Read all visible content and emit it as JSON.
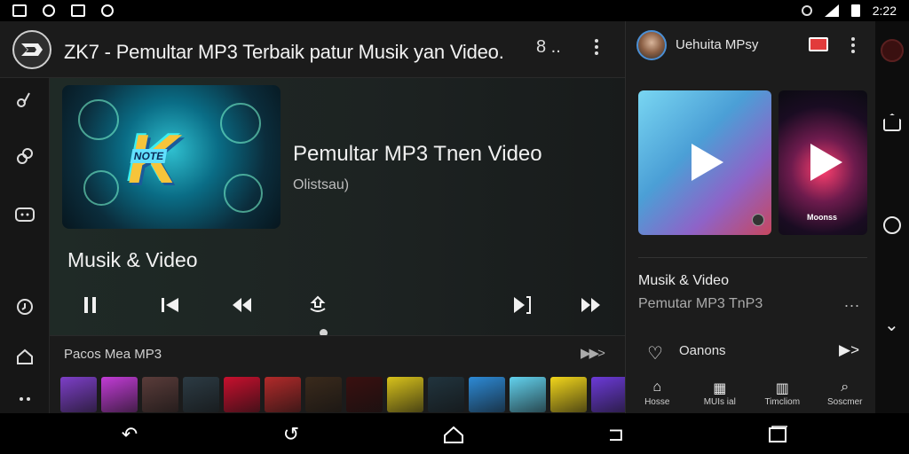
{
  "status_bar": {
    "time": "2:22"
  },
  "header": {
    "title": "ZK7 - Pemultar MP3 Terbaik patur Musik yan Video.",
    "cast_label": "8 .."
  },
  "now_playing": {
    "art_text": "NOTE",
    "art_letter": "K",
    "title": "Pemultar MP3 Tnen Video",
    "subtitle": "Olistsau)"
  },
  "section": {
    "label": "Musik & Video"
  },
  "playlist": {
    "title": "Pacos Mea MP3",
    "thumb_colors": [
      "#7d3fc8",
      "#c23cd6",
      "#5a3c3a",
      "#2c3b44",
      "#c8102e",
      "#b22a2a",
      "#3a2a1c",
      "#3a1010",
      "#d8c21b",
      "#21343e",
      "#2d8ad6",
      "#62d2ee",
      "#f2d61b",
      "#6c3ad8"
    ]
  },
  "right_panel": {
    "account_title": "Uehuita MPsy",
    "card2_label": "Moonss",
    "section_title": "Musik & Video",
    "section_sub": "Pemutar MP3  TnP3",
    "more_label": "...",
    "favorite_label": "Oanons",
    "nav": [
      {
        "icon": "home-icon",
        "label": "Hosse"
      },
      {
        "icon": "library-icon",
        "label": "MUIs ial"
      },
      {
        "icon": "grid-icon",
        "label": "Timcliom"
      },
      {
        "icon": "search-icon",
        "label": "Soscmer"
      }
    ]
  },
  "colors": {
    "accent": "#ff6f6f",
    "panel": "#1c1c1c",
    "background": "#0e0e0e"
  }
}
